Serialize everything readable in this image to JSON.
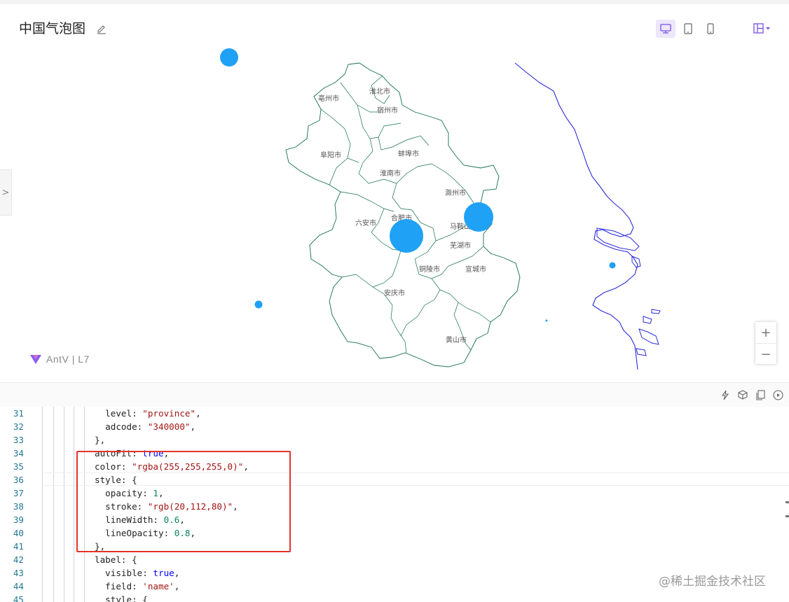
{
  "header": {
    "title": "中国气泡图"
  },
  "map": {
    "city_labels": [
      "亳州市",
      "淮北市",
      "宿州市",
      "阜阳市",
      "蚌埠市",
      "淮南市",
      "滁州市",
      "六安市",
      "合肥市",
      "马鞍山市",
      "芜湖市",
      "铜陵市",
      "宣城市",
      "安庆市",
      "黄山市"
    ],
    "logo_text": "AntV | L7",
    "zoom_in": "+",
    "zoom_out": "−",
    "colors": {
      "bubble": "#1fa1f5",
      "boundary": "#146f50",
      "coast": "#2b2bd9"
    }
  },
  "editor": {
    "lines": [
      {
        "n": "31",
        "code": "  level: \"province\","
      },
      {
        "n": "32",
        "code": "  adcode: \"340000\","
      },
      {
        "n": "33",
        "code": "},"
      },
      {
        "n": "34",
        "code": "autoFit: true,"
      },
      {
        "n": "35",
        "code": "color: \"rgba(255,255,255,0)\","
      },
      {
        "n": "36",
        "code": "style: {"
      },
      {
        "n": "37",
        "code": "  opacity: 1,"
      },
      {
        "n": "38",
        "code": "  stroke: \"rgb(20,112,80)\","
      },
      {
        "n": "39",
        "code": "  lineWidth: 0.6,"
      },
      {
        "n": "40",
        "code": "  lineOpacity: 0.8,"
      },
      {
        "n": "41",
        "code": "},"
      },
      {
        "n": "42",
        "code": "label: {"
      },
      {
        "n": "43",
        "code": "  visible: true,"
      },
      {
        "n": "44",
        "code": "  field: 'name',"
      },
      {
        "n": "45",
        "code": "  style: {"
      }
    ]
  },
  "watermark": "@稀土掘金技术社区"
}
